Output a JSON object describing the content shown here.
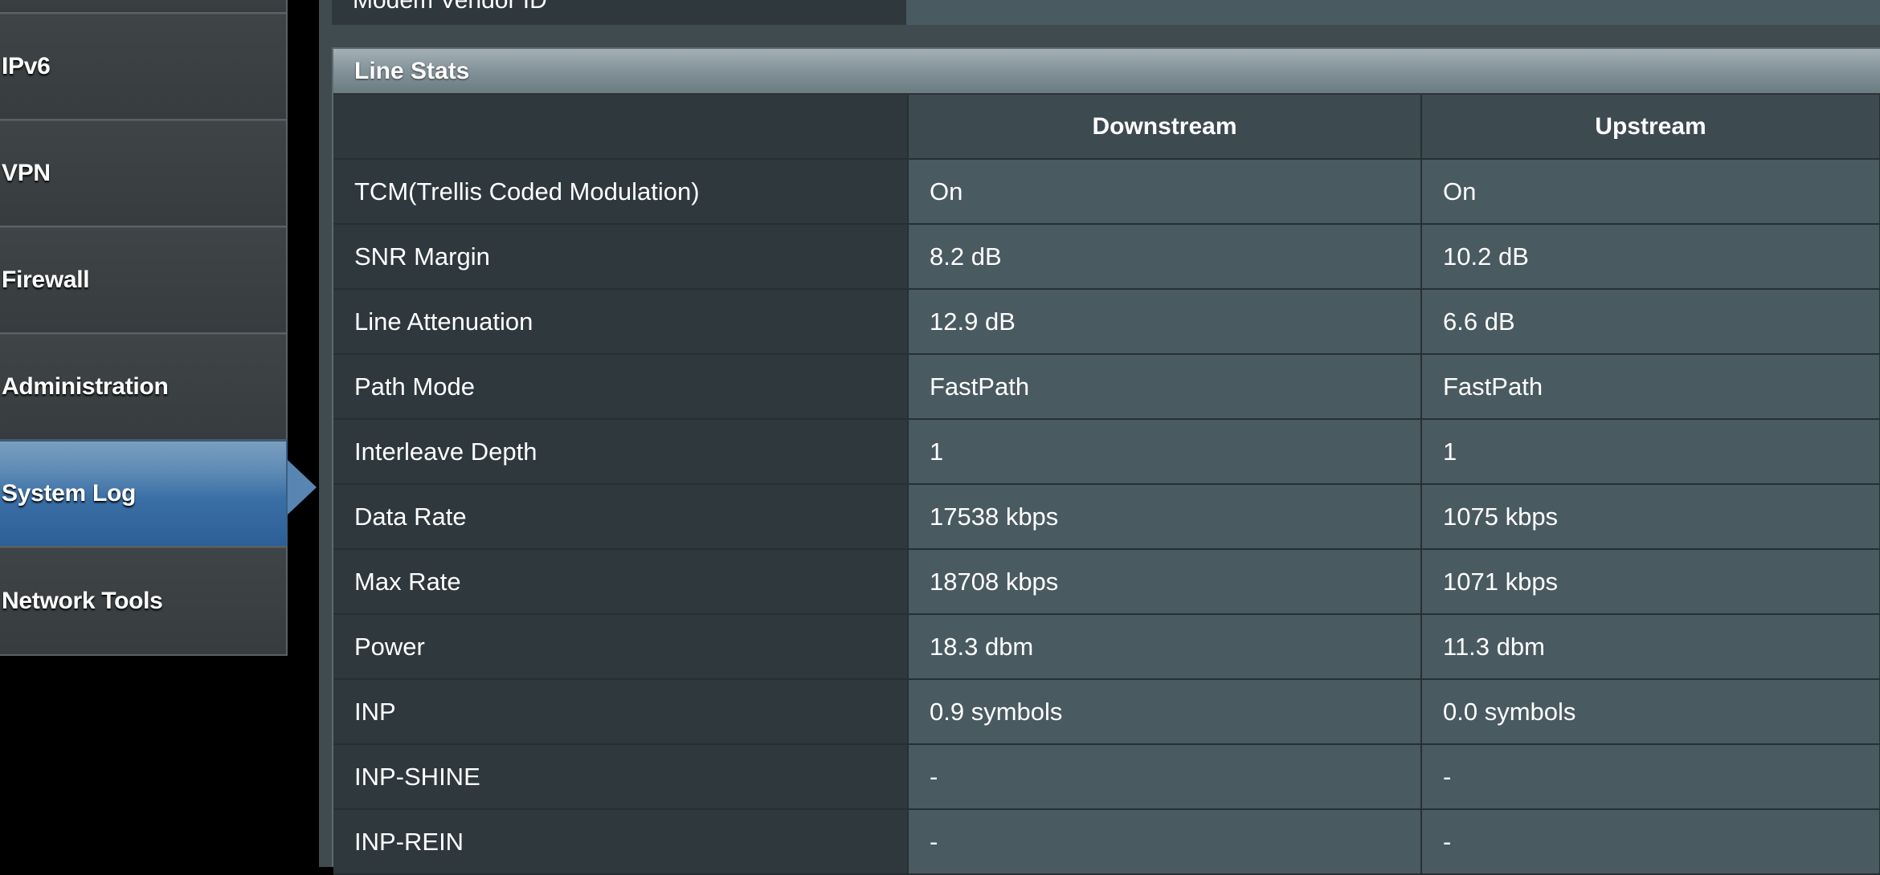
{
  "sidebar": {
    "items": [
      {
        "label": "IPv6",
        "active": false
      },
      {
        "label": "VPN",
        "active": false
      },
      {
        "label": "Firewall",
        "active": false
      },
      {
        "label": "Administration",
        "active": false
      },
      {
        "label": "System Log",
        "active": true
      },
      {
        "label": "Network Tools",
        "active": false
      }
    ]
  },
  "prev_section": {
    "row_label": "Modem Vendor ID"
  },
  "line_stats": {
    "title": "Line Stats",
    "columns": [
      "Downstream",
      "Upstream"
    ],
    "rows": [
      {
        "label": "TCM(Trellis Coded Modulation)",
        "down": "On",
        "up": "On"
      },
      {
        "label": "SNR Margin",
        "down": "8.2 dB",
        "up": "10.2 dB"
      },
      {
        "label": "Line Attenuation",
        "down": "12.9 dB",
        "up": "6.6 dB"
      },
      {
        "label": "Path Mode",
        "down": "FastPath",
        "up": "FastPath"
      },
      {
        "label": "Interleave Depth",
        "down": "1",
        "up": "1"
      },
      {
        "label": "Data Rate",
        "down": "17538 kbps",
        "up": "1075 kbps"
      },
      {
        "label": "Max Rate",
        "down": "18708 kbps",
        "up": "1071 kbps"
      },
      {
        "label": "Power",
        "down": "18.3 dbm",
        "up": "11.3 dbm"
      },
      {
        "label": "INP",
        "down": "0.9 symbols",
        "up": "0.0 symbols"
      },
      {
        "label": "INP-SHINE",
        "down": "-",
        "up": "-"
      },
      {
        "label": "INP-REIN",
        "down": "-",
        "up": "-"
      }
    ]
  }
}
